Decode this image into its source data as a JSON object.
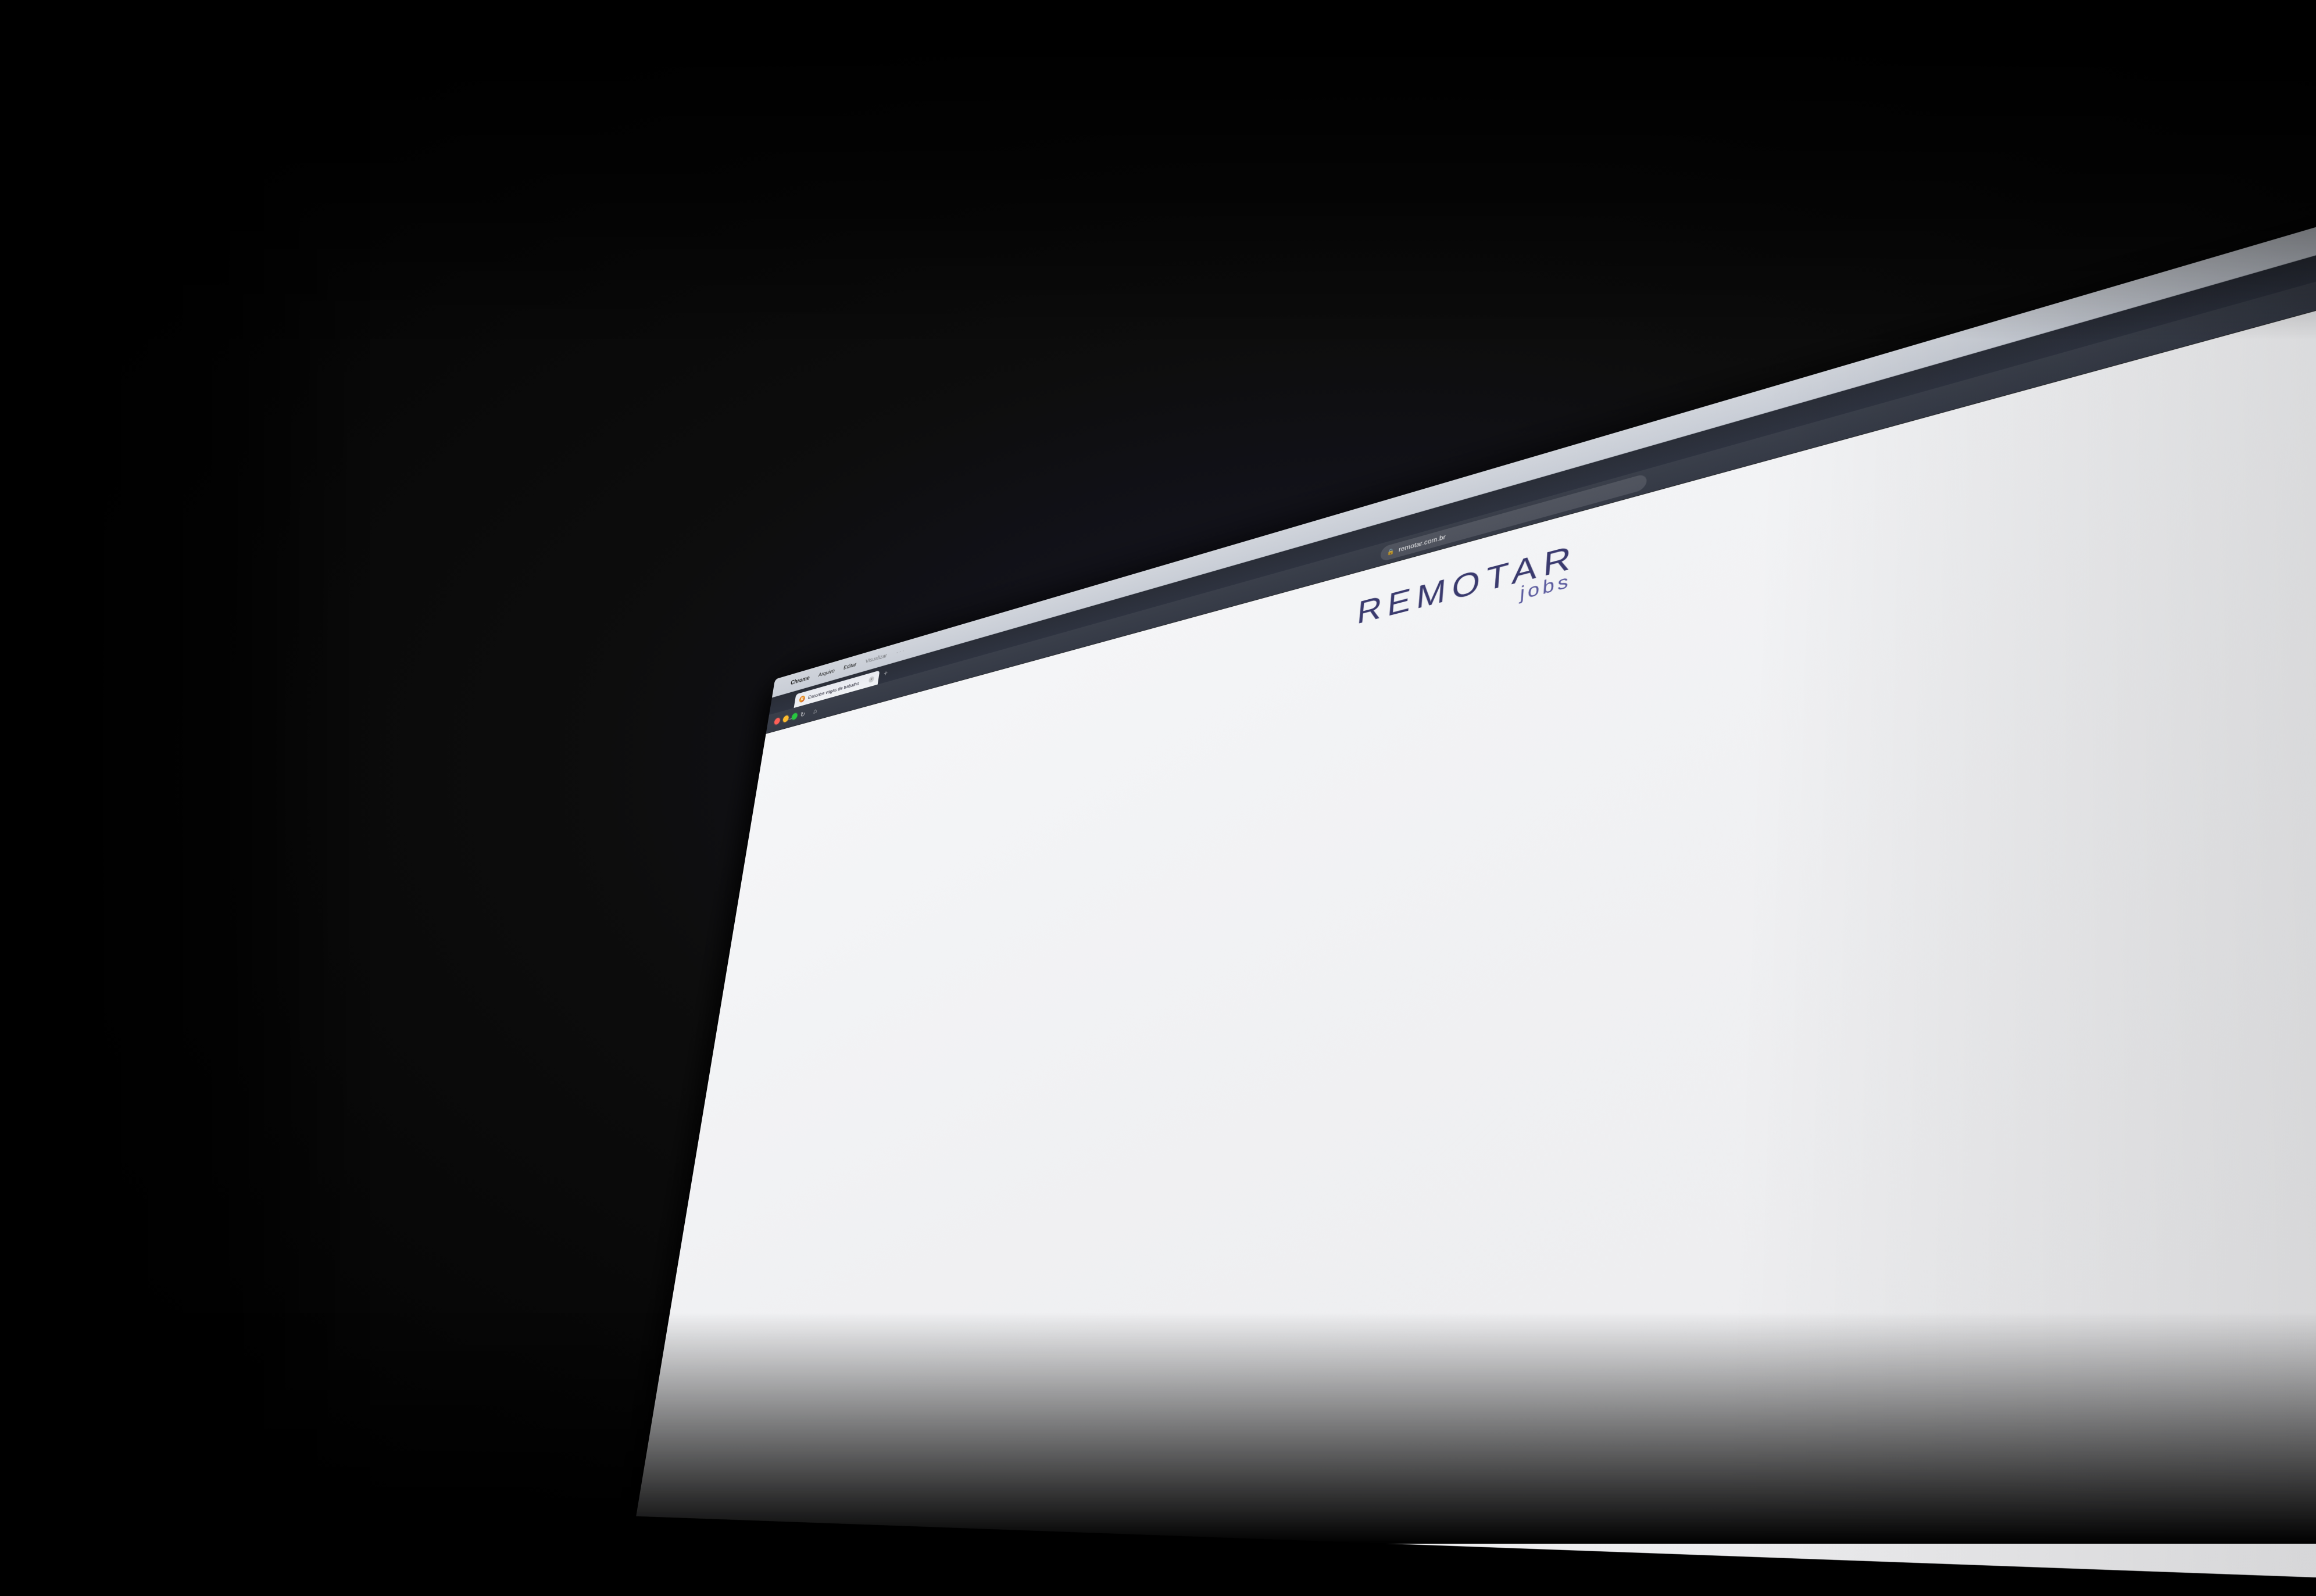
{
  "scene": {
    "background": "#000000"
  },
  "menubar": {
    "apple_symbol": "",
    "items": [
      {
        "label": "Chrome",
        "bold": true
      },
      {
        "label": "Arquivo",
        "bold": false
      },
      {
        "label": "Editar",
        "bold": false
      },
      {
        "label": "Visualizar",
        "bold": false,
        "faded": true
      },
      {
        "label": "...",
        "bold": false,
        "faded": true
      }
    ]
  },
  "browser": {
    "tab": {
      "favicon_letter": "R",
      "title": "Encontre vagas de trabalho",
      "close_symbol": "×"
    },
    "nav": {
      "back": "←",
      "forward": "→",
      "reload": "↻",
      "home": "⌂"
    },
    "address": {
      "lock_icon": "🔒",
      "url": "remotar.com.br"
    },
    "new_tab": "+"
  },
  "website": {
    "logo_remotar": "REMOTAR",
    "logo_jobs": "jobs"
  }
}
